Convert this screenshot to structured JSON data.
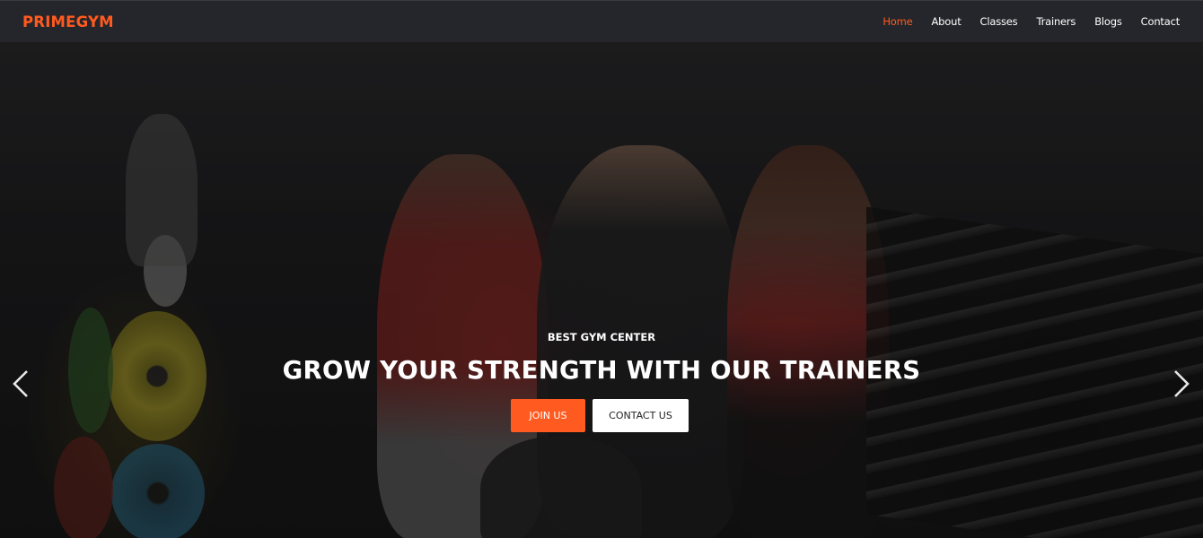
{
  "brand": {
    "name": "PRIMEGYM",
    "accent": "#ff5a1f"
  },
  "nav": {
    "items": [
      {
        "label": "Home",
        "active": true
      },
      {
        "label": "About",
        "active": false
      },
      {
        "label": "Classes",
        "active": false
      },
      {
        "label": "Trainers",
        "active": false
      },
      {
        "label": "Blogs",
        "active": false
      },
      {
        "label": "Contact",
        "active": false
      }
    ]
  },
  "hero": {
    "subtitle": "BEST GYM CENTER",
    "title": "GROW YOUR STRENGTH WITH OUR TRAINERS",
    "primary_button": "JOIN US",
    "secondary_button": "CONTACT US",
    "prev_icon": "chevron-left-icon",
    "next_icon": "chevron-right-icon"
  }
}
